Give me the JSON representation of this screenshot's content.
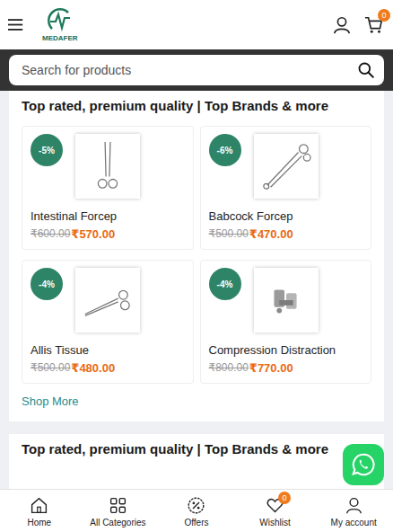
{
  "header": {
    "logo_text": "MEDAFER",
    "cart_badge": "0"
  },
  "search": {
    "placeholder": "Search for products"
  },
  "sections": [
    {
      "title": "Top rated, premium quality | Top Brands & more",
      "products": [
        {
          "name": "Intestinal Forcep",
          "discount": "-5%",
          "old_price": "₹600.00",
          "price": "₹570.00",
          "kind": "forcep"
        },
        {
          "name": "Babcock Forcep",
          "discount": "-6%",
          "old_price": "₹500.00",
          "price": "₹470.00",
          "kind": "babcock"
        },
        {
          "name": "Allis Tissue",
          "discount": "-4%",
          "old_price": "₹500.00",
          "price": "₹480.00",
          "kind": "allis"
        },
        {
          "name": "Compression Distraction",
          "discount": "-4%",
          "old_price": "₹800.00",
          "price": "₹770.00",
          "kind": "device"
        }
      ],
      "link": "Shop More"
    },
    {
      "title": "Top rated, premium quality | Top Brands & more",
      "products": [],
      "link": ""
    }
  ],
  "bottom_nav": [
    {
      "label": "Home",
      "icon": "home",
      "badge": ""
    },
    {
      "label": "All Categories",
      "icon": "grid",
      "badge": ""
    },
    {
      "label": "Offers",
      "icon": "offers",
      "badge": ""
    },
    {
      "label": "Wishlist",
      "icon": "heart",
      "badge": "0"
    },
    {
      "label": "My account",
      "icon": "user",
      "badge": ""
    }
  ]
}
